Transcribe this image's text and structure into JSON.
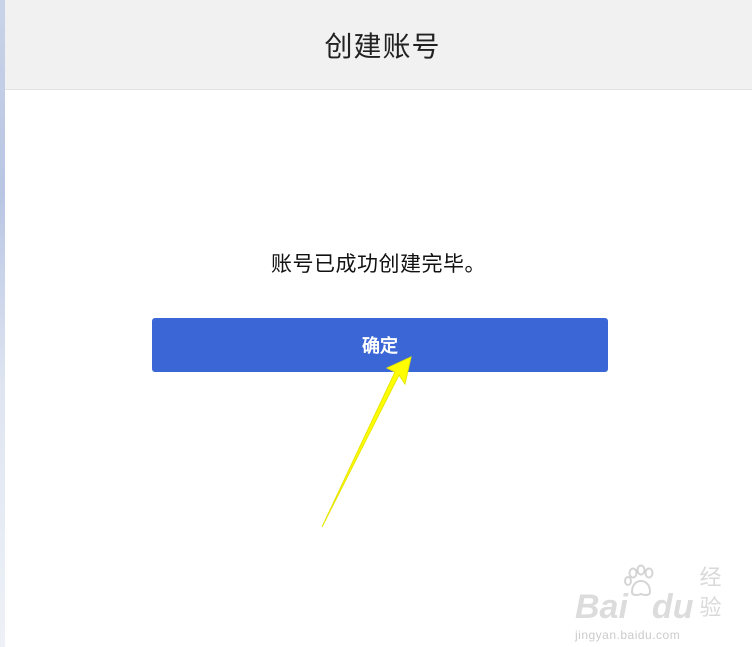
{
  "header": {
    "title": "创建账号"
  },
  "main": {
    "message": "账号已成功创建完毕。",
    "confirm_label": "确定"
  },
  "watermark": {
    "brand_left": "Bai",
    "brand_right": "du",
    "brand_suffix": "经验",
    "url": "jingyan.baidu.com"
  },
  "colors": {
    "header_bg": "#f1f1f1",
    "button_bg": "#3b66d5",
    "button_text": "#ffffff",
    "arrow": "#ffff00"
  },
  "icons": {
    "annotation": "arrow-icon",
    "watermark": "paw-icon"
  }
}
